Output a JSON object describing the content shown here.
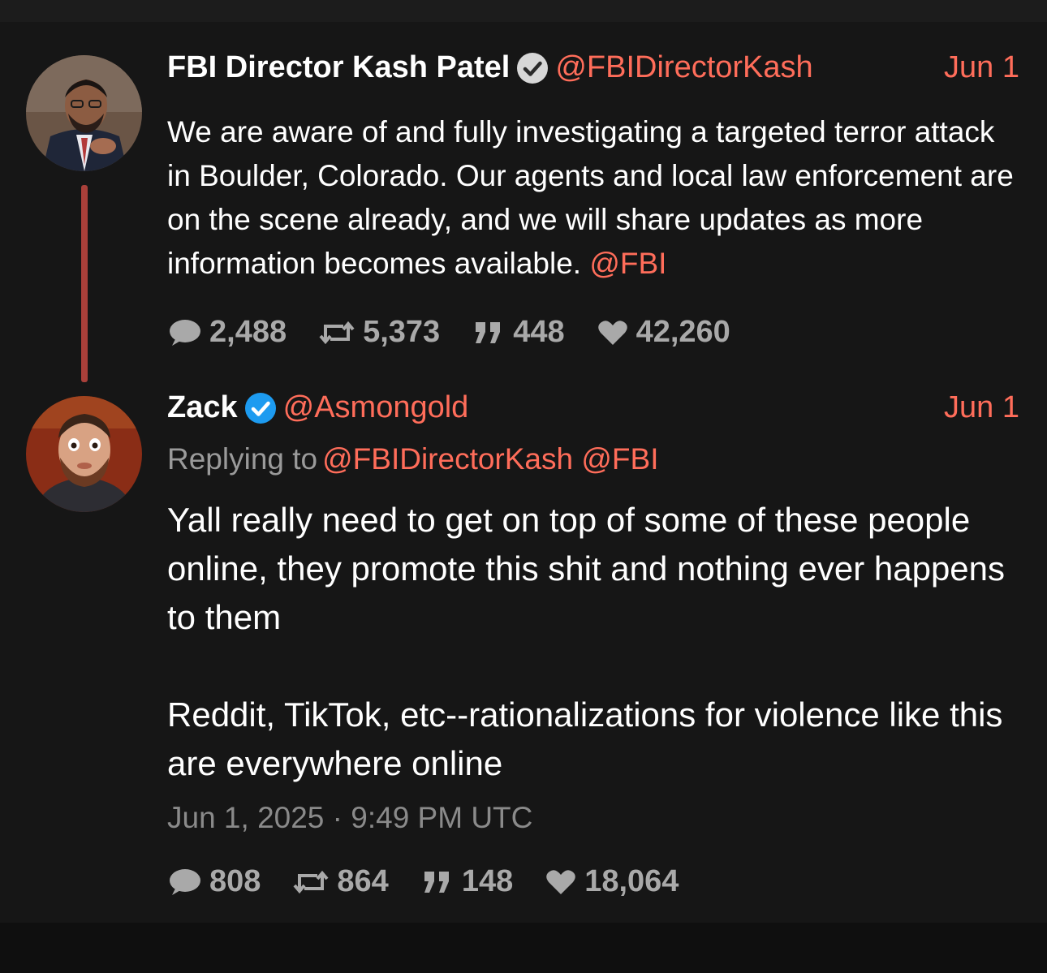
{
  "tweets": [
    {
      "name": "FBI Director Kash Patel",
      "handle": "@FBIDirectorKash",
      "date": "Jun 1",
      "verified_color": "#d7d7d7",
      "text": "We are aware of and fully investigating a targeted terror attack in Boulder, Colorado. Our agents and local law enforcement are on the scene already, and we will share updates as more information becomes available.",
      "mention": "@FBI",
      "stats": {
        "replies": "2,488",
        "retweets": "5,373",
        "quotes": "448",
        "likes": "42,260"
      }
    },
    {
      "name": "Zack",
      "handle": "@Asmongold",
      "date": "Jun 1",
      "verified_color": "#1d9bf0",
      "replying_label": "Replying to",
      "reply_handles": "@FBIDirectorKash @FBI",
      "text": "Yall really need to get on top of some of these people online, they promote this shit and nothing ever happens to them\n\nReddit, TikTok, etc--rationalizations for violence like this are everywhere online",
      "timestamp": "Jun 1, 2025 · 9:49 PM UTC",
      "stats": {
        "replies": "808",
        "retweets": "864",
        "quotes": "148",
        "likes": "18,064"
      }
    }
  ],
  "colors": {
    "accent": "#ff6d5a",
    "thread_line": "#a9403a",
    "stat_text": "#a9a9a9",
    "background": "#161616"
  },
  "icons": [
    "comment-icon",
    "retweet-icon",
    "quote-icon",
    "heart-icon",
    "verified-badge-icon"
  ]
}
